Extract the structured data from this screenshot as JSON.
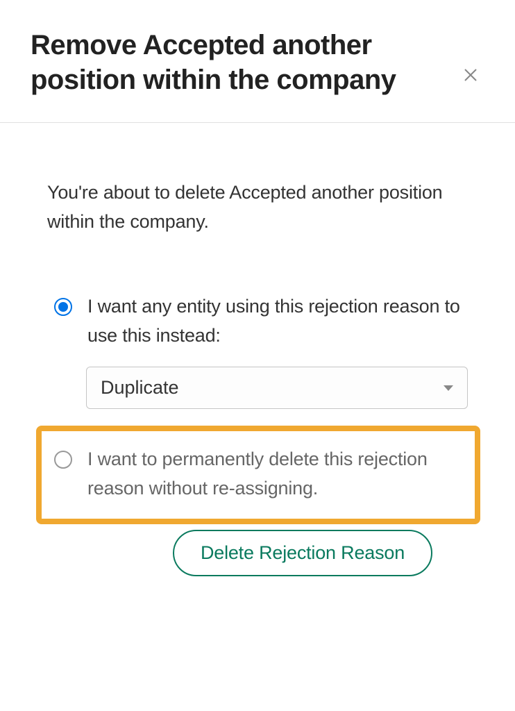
{
  "header": {
    "title": "Remove Accepted another position within the company"
  },
  "body": {
    "intro": "You're about to delete Accepted another position within the company.",
    "option1_label": "I want any entity using this rejection reason to use this instead:",
    "select_value": "Duplicate",
    "option2_label": "I want to permanently delete this rejection reason without re-assigning."
  },
  "actions": {
    "delete_label": "Delete Rejection Reason"
  }
}
